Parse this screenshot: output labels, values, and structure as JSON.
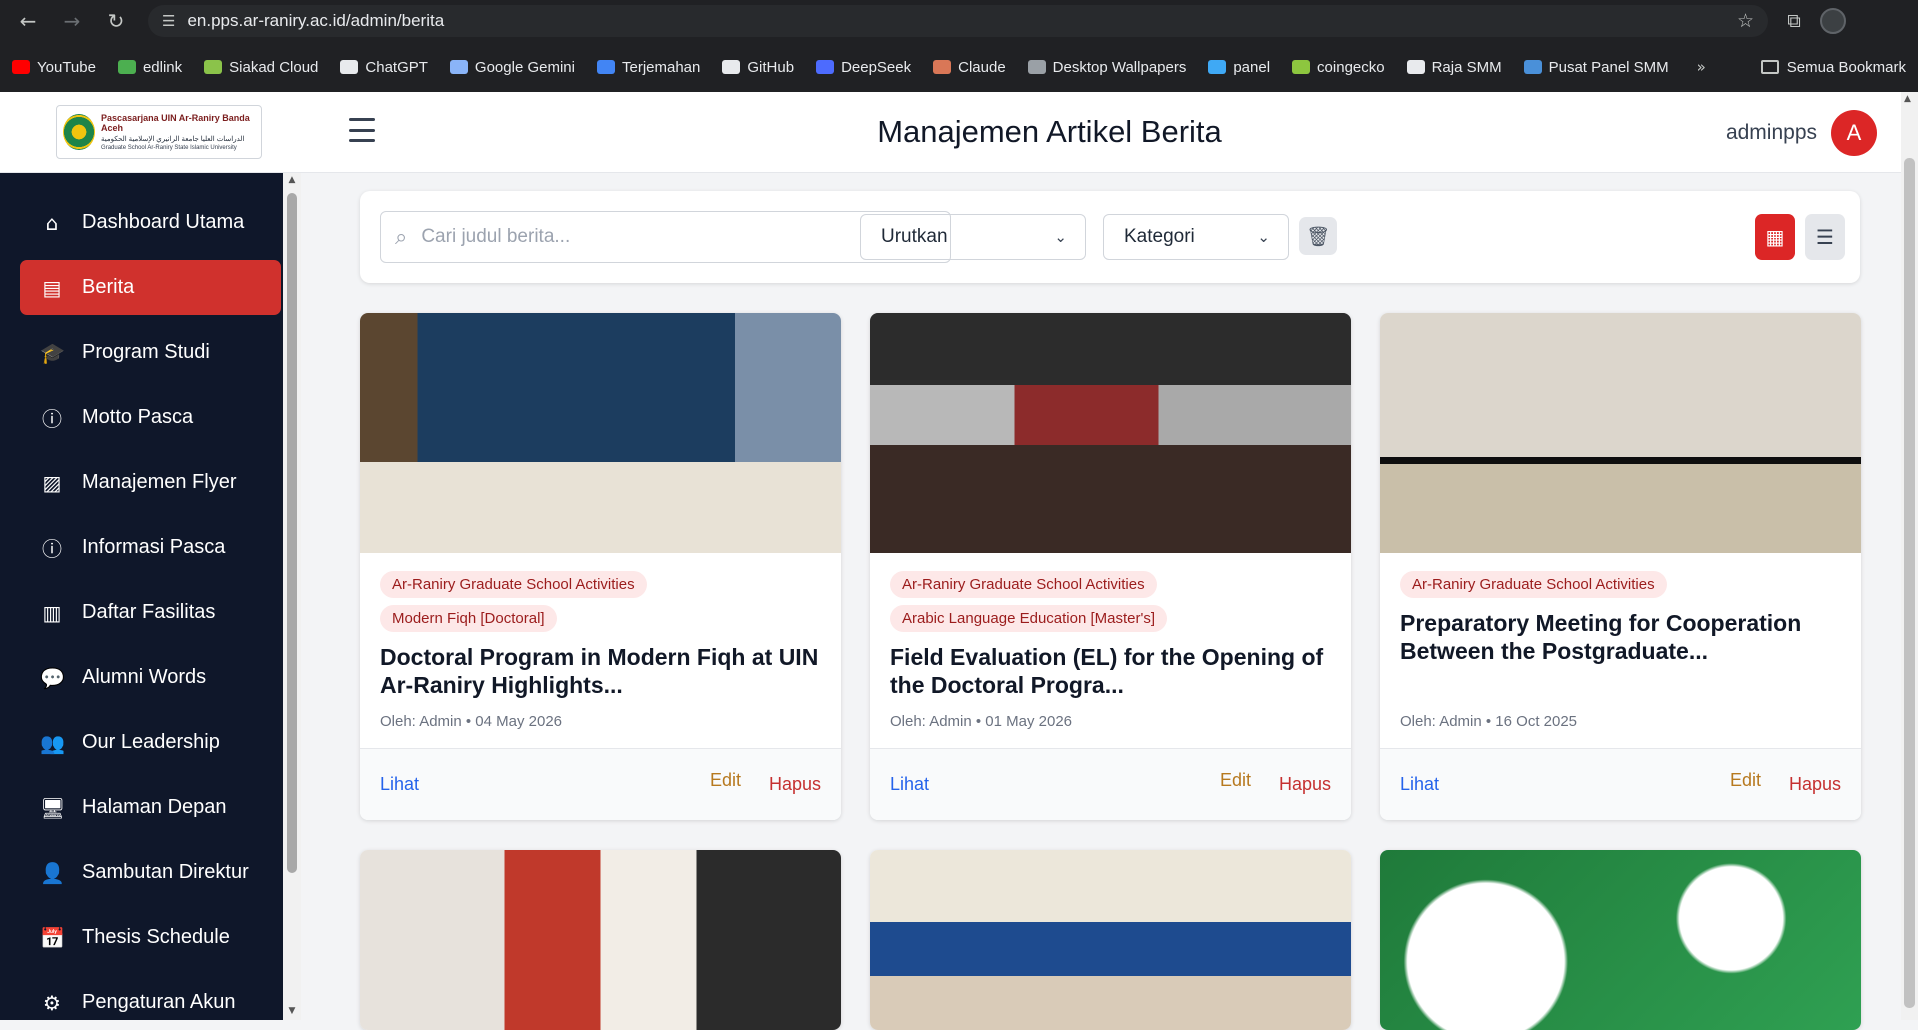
{
  "browser": {
    "url": "en.pps.ar-raniry.ac.id/admin/berita",
    "bookmarks": [
      {
        "label": "YouTube",
        "color": "#ff0000"
      },
      {
        "label": "edlink",
        "color": "#4caf50"
      },
      {
        "label": "Siakad Cloud",
        "color": "#8bc34a"
      },
      {
        "label": "ChatGPT",
        "color": "#e8eaed"
      },
      {
        "label": "Google Gemini",
        "color": "#8ab4f8"
      },
      {
        "label": "Terjemahan",
        "color": "#4285f4"
      },
      {
        "label": "GitHub",
        "color": "#e8eaed"
      },
      {
        "label": "DeepSeek",
        "color": "#4d6bfe"
      },
      {
        "label": "Claude",
        "color": "#d97757"
      },
      {
        "label": "Desktop Wallpapers",
        "color": "#9aa0a6"
      },
      {
        "label": "panel",
        "color": "#3fa9f5"
      },
      {
        "label": "coingecko",
        "color": "#8dc63f"
      },
      {
        "label": "Raja SMM",
        "color": "#e8eaed"
      },
      {
        "label": "Pusat Panel SMM",
        "color": "#4a90d9"
      }
    ],
    "all_bookmarks": "Semua Bookmark"
  },
  "logo": {
    "line1": "Pascasarjana UIN Ar-Raniry Banda Aceh",
    "line2": "الدراسات العليا جامعة الرانيري الإسلامية الحكومية",
    "line3": "Graduate School Ar-Raniry State Islamic University"
  },
  "sidebar": {
    "items": [
      {
        "label": "Dashboard Utama",
        "icon": "home-icon"
      },
      {
        "label": "Berita",
        "icon": "newspaper-icon",
        "active": true
      },
      {
        "label": "Program Studi",
        "icon": "graduation-cap-icon"
      },
      {
        "label": "Motto Pasca",
        "icon": "info-icon"
      },
      {
        "label": "Manajemen Flyer",
        "icon": "image-icon"
      },
      {
        "label": "Informasi Pasca",
        "icon": "info-icon"
      },
      {
        "label": "Daftar Fasilitas",
        "icon": "building-icon"
      },
      {
        "label": "Alumni Words",
        "icon": "comment-icon"
      },
      {
        "label": "Our Leadership",
        "icon": "users-icon"
      },
      {
        "label": "Halaman Depan",
        "icon": "monitor-icon"
      },
      {
        "label": "Sambutan Direktur",
        "icon": "user-icon"
      },
      {
        "label": "Thesis Schedule",
        "icon": "calendar-icon"
      },
      {
        "label": "Pengaturan Akun",
        "icon": "user-gear-icon"
      }
    ]
  },
  "header": {
    "title": "Manajemen Artikel Berita",
    "username": "adminpps",
    "avatar_letter": "A"
  },
  "filters": {
    "search_placeholder": "Cari judul berita...",
    "sort_label": "Urutkan",
    "category_label": "Kategori"
  },
  "cards": [
    {
      "tags": [
        "Ar-Raniry Graduate School Activities",
        "Modern Fiqh [Doctoral]"
      ],
      "title": "Doctoral Program in Modern Fiqh at UIN Ar-Raniry Highlights...",
      "meta": "Oleh: Admin • 04 May 2026",
      "view": "Lihat",
      "edit": "Edit",
      "delete": "Hapus"
    },
    {
      "tags": [
        "Ar-Raniry Graduate School Activities",
        "Arabic Language Education [Master's]"
      ],
      "title": "Field Evaluation (EL) for the Opening of the Doctoral Progra...",
      "meta": "Oleh: Admin • 01 May 2026",
      "view": "Lihat",
      "edit": "Edit",
      "delete": "Hapus"
    },
    {
      "tags": [
        "Ar-Raniry Graduate School Activities"
      ],
      "title": "Preparatory Meeting for Cooperation Between the Postgraduate...",
      "meta": "Oleh: Admin • 16 Oct 2025",
      "view": "Lihat",
      "edit": "Edit",
      "delete": "Hapus"
    }
  ],
  "colors": {
    "accent": "#dc2626",
    "sidebar_bg": "#0f172a",
    "tag_bg": "#fde8e8",
    "tag_text": "#9b1c1c",
    "link_view": "#2563eb",
    "link_edit": "#b7791f",
    "link_delete": "#c53030"
  }
}
